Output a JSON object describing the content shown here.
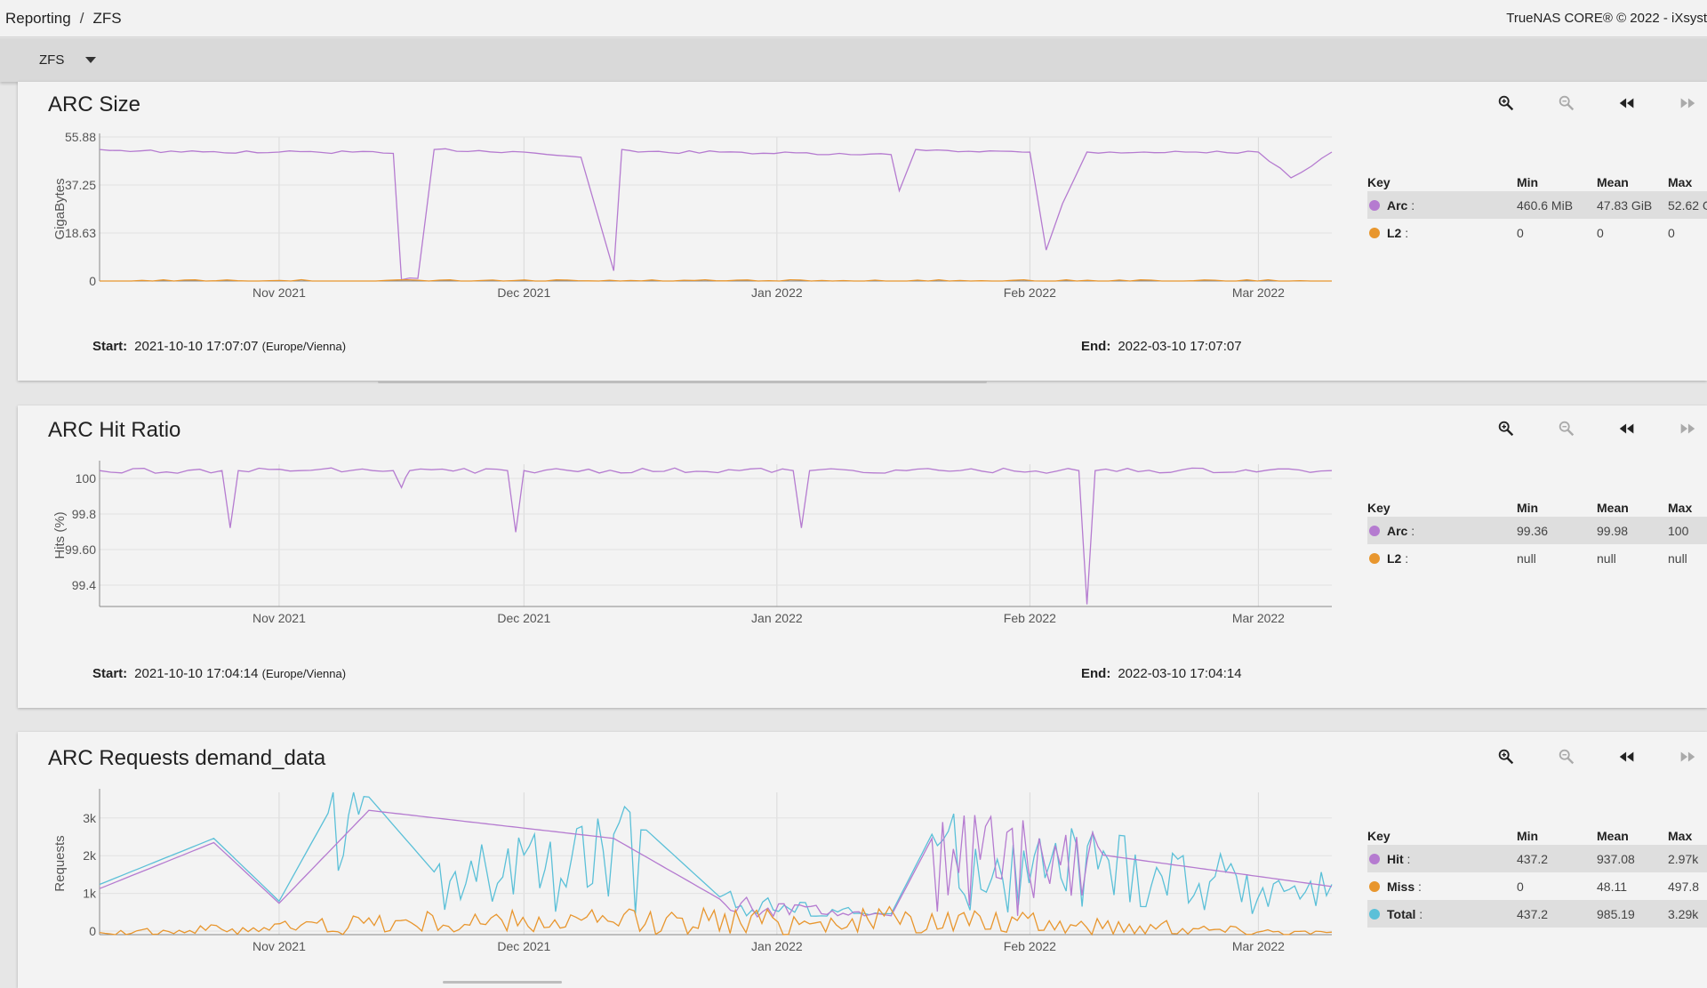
{
  "breadcrumb": {
    "root": "Reporting",
    "separator": "/",
    "current": "ZFS"
  },
  "copyright": "TrueNAS CORE® © 2022 - iXsyst",
  "selector": {
    "value": "ZFS"
  },
  "x_tick_labels": [
    "Nov 2021",
    "Dec 2021",
    "Jan 2022",
    "Feb 2022",
    "Mar 2022"
  ],
  "legend_headers": {
    "key": "Key",
    "min": "Min",
    "mean": "Mean",
    "max": "Max"
  },
  "labels": {
    "start": "Start:",
    "end": "End:"
  },
  "colors": {
    "arc": "#b57bd0",
    "l2": "#e8962e",
    "total": "#5bc0d8",
    "hit": "#b57bd0",
    "miss": "#e8962e"
  },
  "cards": [
    {
      "title": "ARC Size",
      "ylabel": "GigaBytes",
      "y_ticks": [
        "55.88",
        "37.25",
        "18.63",
        "0"
      ],
      "legend": [
        {
          "name": "Arc :",
          "min": "460.6 MiB",
          "mean": "47.83 GiB",
          "max": "52.62 G"
        },
        {
          "name": "L2 :",
          "min": "0",
          "mean": "0",
          "max": "0"
        }
      ],
      "start": "2021-10-10 17:07:07",
      "tz": "(Europe/Vienna)",
      "end": "2022-03-10 17:07:07"
    },
    {
      "title": "ARC Hit Ratio",
      "ylabel": "Hits (%)",
      "y_ticks": [
        "100",
        "99.8",
        "99.60",
        "99.4"
      ],
      "legend": [
        {
          "name": "Arc :",
          "min": "99.36",
          "mean": "99.98",
          "max": "100"
        },
        {
          "name": "L2 :",
          "min": "null",
          "mean": "null",
          "max": "null"
        }
      ],
      "start": "2021-10-10 17:04:14",
      "tz": "(Europe/Vienna)",
      "end": "2022-03-10 17:04:14"
    },
    {
      "title": "ARC Requests demand_data",
      "ylabel": "Requests",
      "y_ticks": [
        "3k",
        "2k",
        "1k",
        "0"
      ],
      "legend": [
        {
          "name": "Hit :",
          "min": "437.2",
          "mean": "937.08",
          "max": "2.97k"
        },
        {
          "name": "Miss :",
          "min": "0",
          "mean": "48.11",
          "max": "497.8"
        },
        {
          "name": "Total :",
          "min": "437.2",
          "mean": "985.19",
          "max": "3.29k"
        }
      ]
    }
  ],
  "chart_data": [
    {
      "type": "line",
      "title": "ARC Size",
      "ylabel": "GigaBytes",
      "x_range": [
        "2021-10-10",
        "2022-03-10"
      ],
      "ylim": [
        0,
        55.88
      ],
      "series": [
        {
          "name": "Arc",
          "x": [
            "2021-10-10",
            "2021-10-20",
            "2021-11-01",
            "2021-11-10",
            "2021-11-15",
            "2021-11-16",
            "2021-11-18",
            "2021-11-20",
            "2021-12-01",
            "2021-12-08",
            "2021-12-12",
            "2021-12-13",
            "2021-12-15",
            "2021-12-25",
            "2022-01-10",
            "2022-01-15",
            "2022-01-16",
            "2022-01-18",
            "2022-01-31",
            "2022-02-01",
            "2022-02-03",
            "2022-02-05",
            "2022-02-08",
            "2022-02-15",
            "2022-03-01",
            "2022-03-05",
            "2022-03-10"
          ],
          "y": [
            51,
            50,
            50,
            50,
            49.5,
            0.5,
            1,
            51,
            50,
            48,
            4,
            51,
            50,
            50,
            49,
            49,
            35,
            51,
            50,
            50,
            12,
            30,
            50,
            50,
            50,
            40,
            50
          ]
        },
        {
          "name": "L2",
          "x": [
            "2021-10-10",
            "2022-03-10"
          ],
          "y": [
            0,
            0
          ]
        }
      ]
    },
    {
      "type": "line",
      "title": "ARC Hit Ratio",
      "ylabel": "Hits (%)",
      "x_range": [
        "2021-10-10",
        "2022-03-10"
      ],
      "ylim": [
        99.35,
        100.02
      ],
      "series": [
        {
          "name": "Arc",
          "x": [
            "2021-10-10",
            "2021-10-25",
            "2021-10-26",
            "2021-10-27",
            "2021-11-15",
            "2021-11-16",
            "2021-11-17",
            "2021-11-29",
            "2021-11-30",
            "2021-12-01",
            "2022-01-03",
            "2022-01-04",
            "2022-01-05",
            "2022-02-07",
            "2022-02-08",
            "2022-02-09",
            "2022-03-10"
          ],
          "y": [
            99.99,
            99.99,
            99.72,
            99.99,
            99.99,
            99.91,
            99.99,
            99.99,
            99.7,
            99.99,
            99.99,
            99.72,
            99.99,
            99.99,
            99.36,
            99.99,
            99.99
          ]
        },
        {
          "name": "L2",
          "x": [],
          "y": []
        }
      ]
    },
    {
      "type": "line",
      "title": "ARC Requests demand_data",
      "ylabel": "Requests",
      "x_range": [
        "2021-10-10",
        "2022-03-10"
      ],
      "ylim": [
        0,
        3400
      ],
      "series": [
        {
          "name": "Total",
          "x": [
            "2021-10-10",
            "2021-10-24",
            "2021-11-01",
            "2021-11-07",
            "2021-11-12",
            "2021-11-20",
            "2021-12-01",
            "2021-12-12",
            "2021-12-16",
            "2021-12-25",
            "2022-01-15",
            "2022-01-20",
            "2022-01-28",
            "2022-02-10",
            "2022-02-25",
            "2022-03-10"
          ],
          "y": [
            1200,
            2300,
            800,
            2900,
            3290,
            1500,
            1900,
            2400,
            2500,
            900,
            500,
            2400,
            1800,
            2000,
            1500,
            1200
          ]
        },
        {
          "name": "Hit",
          "x": [
            "2021-10-10",
            "2021-10-24",
            "2021-11-01",
            "2021-11-12",
            "2021-12-12",
            "2021-12-25",
            "2022-01-15",
            "2022-01-20",
            "2022-02-10",
            "2022-03-10"
          ],
          "y": [
            1100,
            2200,
            750,
            2970,
            2300,
            850,
            450,
            2300,
            1900,
            1150
          ]
        },
        {
          "name": "Miss",
          "x": [
            "2021-10-10",
            "2021-11-05",
            "2021-11-12",
            "2022-01-20",
            "2022-03-10"
          ],
          "y": [
            50,
            300,
            400,
            497.8,
            60
          ]
        }
      ]
    }
  ]
}
